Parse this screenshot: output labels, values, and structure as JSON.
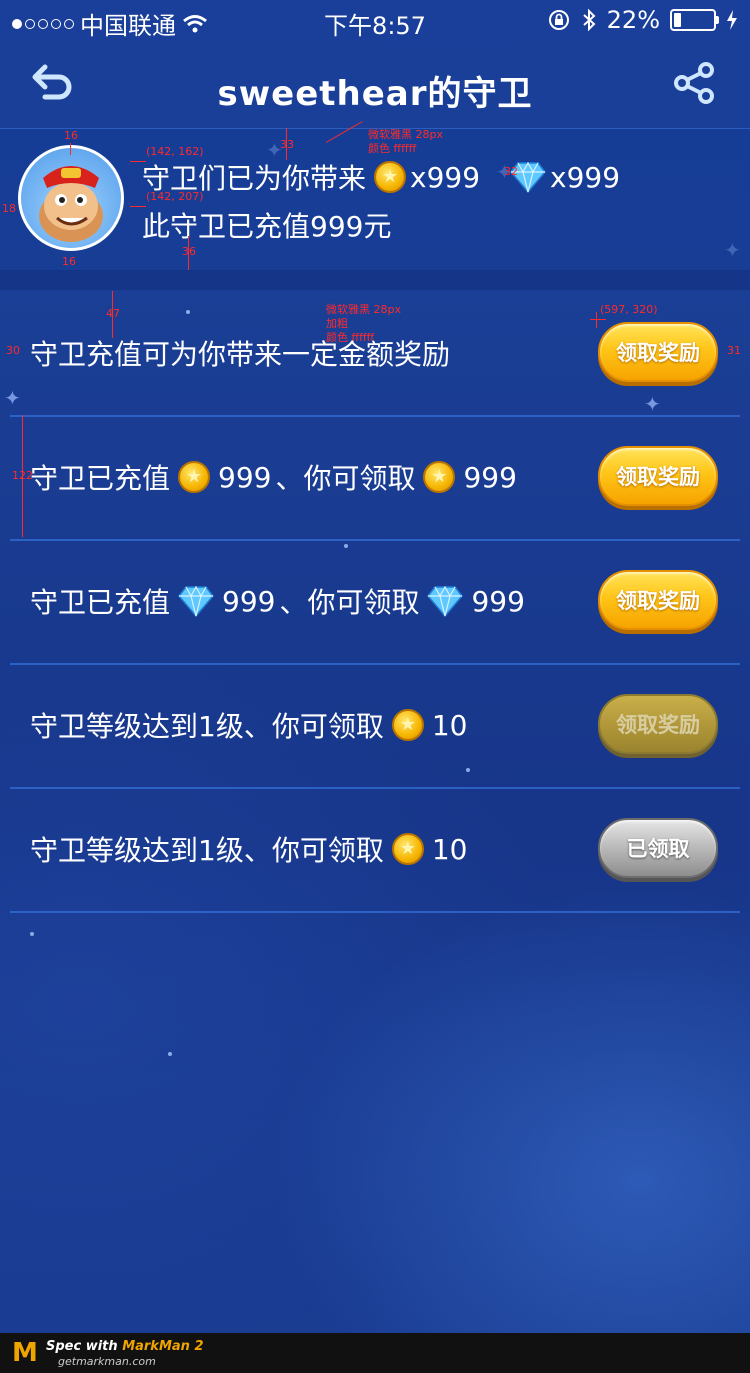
{
  "status_bar": {
    "carrier": "中国联通",
    "time": "下午8:57",
    "battery": "22%",
    "battery_level": 0.22
  },
  "nav": {
    "title": "sweethear的守卫",
    "back_icon": "back-arrow-icon",
    "share_icon": "share-icon"
  },
  "header": {
    "line1_prefix": "守卫们已为你带来",
    "coin_amount": "x999",
    "gem_amount": "x999",
    "line2": "此守卫已充值999元"
  },
  "rewards": [
    {
      "label": "守卫充值可为你带来一定金额奖励",
      "button": "领取奖励",
      "state": "active"
    },
    {
      "label_a": "守卫已充值",
      "value_a": "999",
      "label_b": "、你可领取",
      "value_b": "999",
      "currency": "coin",
      "button": "领取奖励",
      "state": "active"
    },
    {
      "label_a": "守卫已充值",
      "value_a": "999",
      "label_b": "、你可领取",
      "value_b": "999",
      "currency": "gem",
      "button": "领取奖励",
      "state": "active"
    },
    {
      "label_a": "守卫等级达到1级、你可领取",
      "value_b": "10",
      "currency": "coin",
      "button": "领取奖励",
      "state": "disabled"
    },
    {
      "label_a": "守卫等级达到1级、你可领取",
      "value_b": "10",
      "currency": "coin",
      "button": "已领取",
      "state": "claimed"
    }
  ],
  "annotations": {
    "a16_top": "16",
    "a33": "33",
    "font_spec_1": "微软雅黑 28px",
    "color_spec_1": "颜色 ffffff",
    "coord_1": "(142, 162)",
    "coord_2": "(142, 207)",
    "a18": "18",
    "a32": "32",
    "a16_bottom": "16",
    "a36": "36",
    "a47": "47",
    "font_spec_2": "微软雅黑 28px",
    "bold_spec_2": "加粗",
    "color_spec_2": "颜色 ffffff",
    "coord_3": "(597, 320)",
    "a30": "30",
    "a31": "31",
    "a122": "122"
  },
  "footer": {
    "brand_prefix": "Spec with ",
    "brand": "MarkMan 2",
    "url": "getmarkman.com"
  },
  "colors": {
    "background": "#1a3f9a",
    "button_gold": "#ffc517",
    "row_divider": "#3c82f0",
    "annotation": "#ff2a2a"
  }
}
